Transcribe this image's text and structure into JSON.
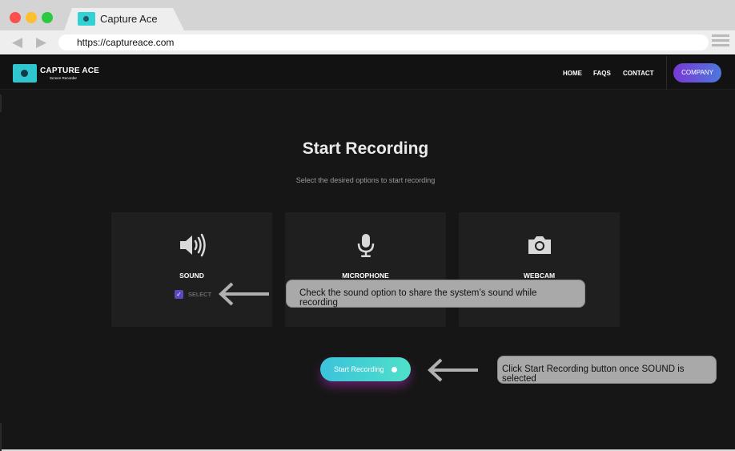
{
  "browser": {
    "tab_title": "Capture Ace",
    "url": "https://captureace.com",
    "back_glyph": "◀",
    "forward_glyph": "▶"
  },
  "site": {
    "logo_title": "CAPTURE ACE",
    "logo_subtitle": "Screen Recorder",
    "nav": {
      "home": "HOME",
      "faqs": "FAQS",
      "contact": "CONTACT"
    },
    "company_button": "COMPANY"
  },
  "main": {
    "title": "Start Recording",
    "subtitle": "Select the desired options to start recording",
    "options": [
      {
        "label": "SOUND",
        "icon": "speaker-icon",
        "checkbox_label": "SELECT",
        "checked": true
      },
      {
        "label": "MICROPHONE",
        "icon": "microphone-icon"
      },
      {
        "label": "WEBCAM",
        "icon": "camera-icon"
      }
    ],
    "start_button": "Start Recording"
  },
  "annotations": {
    "sound_tip": "Check the sound option to share the system’s sound while recording",
    "start_tip": "Click Start Recording button once SOUND is selected"
  },
  "colors": {
    "accent_teal": "#3bc3dc",
    "accent_purple": "#7a38d6",
    "page_bg": "#161616",
    "card_bg": "#1f1f1f",
    "callout_bg": "#a9a9a9"
  }
}
